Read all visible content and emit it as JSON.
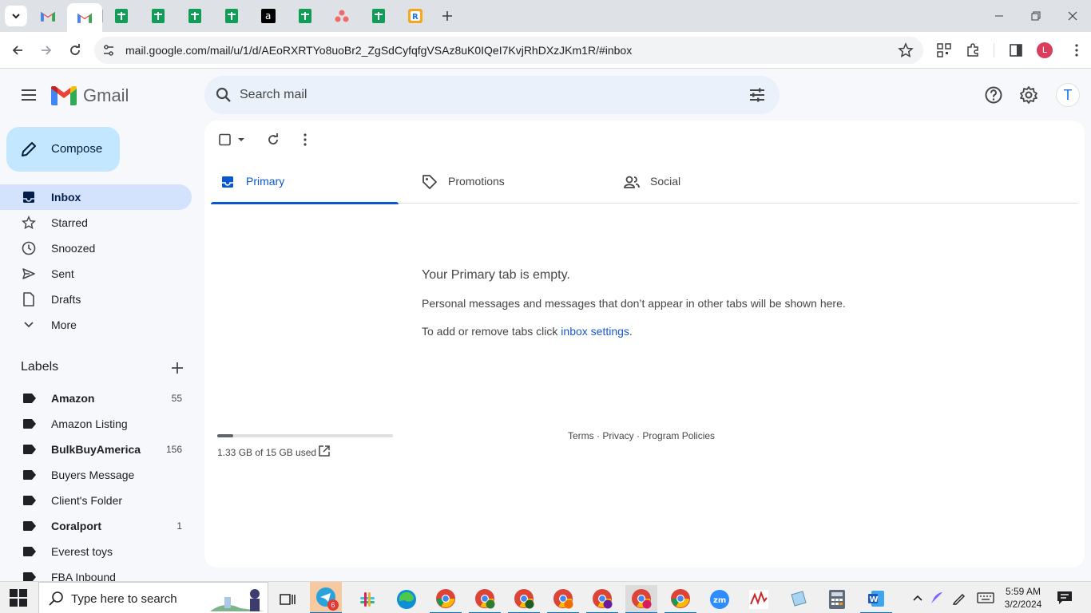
{
  "browser": {
    "url": "mail.google.com/mail/u/1/d/AEoRXRTYo8uoBr2_ZgSdCyfqfgVSAz8uK0IQeI7KvjRhDXzJKm1R/#inbox",
    "profile_initial": "L"
  },
  "gmail": {
    "brand": "Gmail",
    "search_placeholder": "Search mail",
    "account_initial": "T",
    "compose_label": "Compose",
    "nav": [
      {
        "label": "Inbox",
        "icon": "inbox-icon",
        "active": true
      },
      {
        "label": "Starred",
        "icon": "star-icon"
      },
      {
        "label": "Snoozed",
        "icon": "clock-icon"
      },
      {
        "label": "Sent",
        "icon": "send-icon"
      },
      {
        "label": "Drafts",
        "icon": "draft-icon"
      },
      {
        "label": "More",
        "icon": "chevron-down-icon"
      }
    ],
    "labels_heading": "Labels",
    "labels": [
      {
        "name": "Amazon",
        "count": "55",
        "bold": true
      },
      {
        "name": "Amazon Listing",
        "count": ""
      },
      {
        "name": "BulkBuyAmerica",
        "count": "156",
        "bold": true
      },
      {
        "name": "Buyers Message",
        "count": ""
      },
      {
        "name": "Client's Folder",
        "count": ""
      },
      {
        "name": "Coralport",
        "count": "1",
        "bold": true
      },
      {
        "name": "Everest toys",
        "count": ""
      },
      {
        "name": "FBA Inbound",
        "count": ""
      }
    ],
    "tabs": [
      {
        "label": "Primary",
        "active": true
      },
      {
        "label": "Promotions"
      },
      {
        "label": "Social"
      }
    ],
    "empty": {
      "title": "Your Primary tab is empty.",
      "line1": "Personal messages and messages that don’t appear in other tabs will be shown here.",
      "line2_prefix": "To add or remove tabs click ",
      "line2_link": "inbox settings",
      "line2_suffix": "."
    },
    "storage": {
      "text": "1.33 GB of 15 GB used",
      "fraction": 0.089
    },
    "footer": {
      "terms": "Terms",
      "privacy": "Privacy",
      "policies": "Program Policies",
      "sep": " · "
    }
  },
  "taskbar": {
    "search_text": "Type here to search",
    "time": "5:59 AM",
    "date": "3/2/2024",
    "telegram_badge": "6"
  },
  "colors": {
    "accent": "#0b57d0",
    "compose_bg": "#c2e7ff",
    "active_nav": "#d3e3fd"
  }
}
